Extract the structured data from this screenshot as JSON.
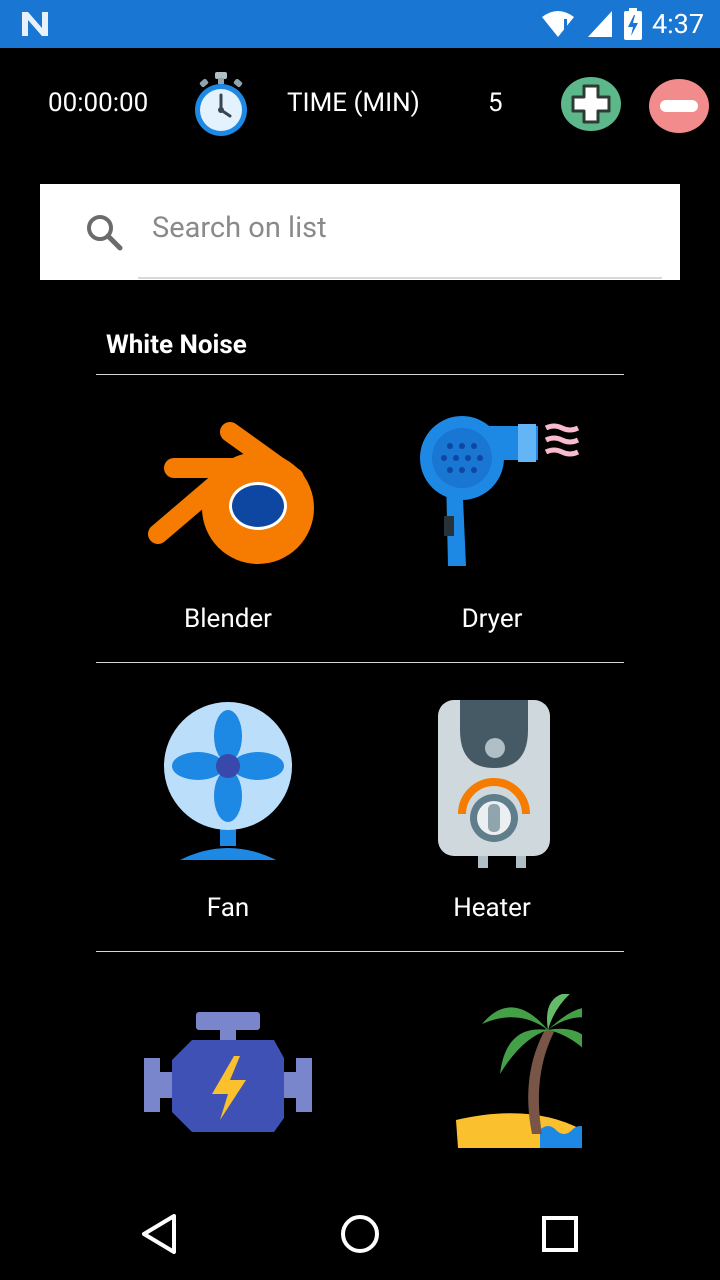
{
  "status_bar": {
    "time": "4:37"
  },
  "toolbar": {
    "timer": "00:00:00",
    "time_label": "TIME (MIN)",
    "time_value": "5"
  },
  "search": {
    "placeholder": "Search on list",
    "value": ""
  },
  "section": {
    "title": "White Noise"
  },
  "items": [
    {
      "label": "Blender",
      "icon": "blender-icon"
    },
    {
      "label": "Dryer",
      "icon": "hair-dryer-icon"
    },
    {
      "label": "Fan",
      "icon": "fan-icon"
    },
    {
      "label": "Heater",
      "icon": "water-heater-icon"
    },
    {
      "label": "",
      "icon": "engine-icon"
    },
    {
      "label": "",
      "icon": "palm-beach-icon"
    }
  ],
  "colors": {
    "status_bar": "#1976d2",
    "plus_button": "#4caf8a",
    "minus_button": "#f28b8b",
    "background": "#000000"
  }
}
